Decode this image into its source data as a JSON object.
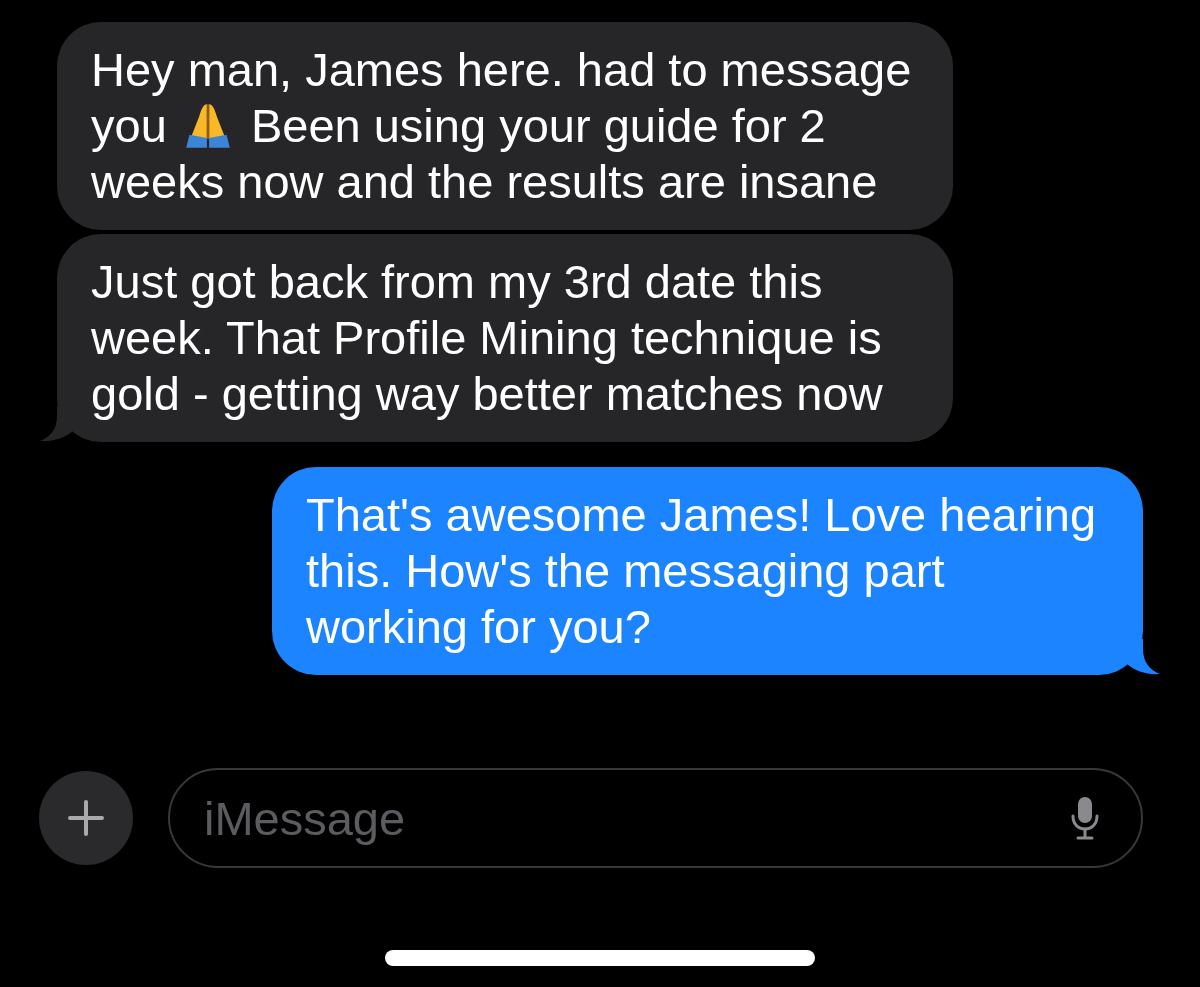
{
  "conversation": {
    "messages": [
      {
        "kind": "incoming",
        "tail": false,
        "parts": [
          {
            "kind": "text",
            "text": "Hey man, James here. had to message"
          },
          {
            "kind": "text",
            "text": "you"
          },
          {
            "kind": "emoji"
          },
          {
            "kind": "text",
            "text": "Been using your guide for 2"
          },
          {
            "kind": "text",
            "text": "weeks now and the results are insane"
          }
        ]
      },
      {
        "kind": "incoming",
        "tail": true,
        "parts": [
          {
            "kind": "text",
            "text": "Just got back from my 3rd date this week. That Profile Mining technique is gold - getting way better matches now"
          }
        ]
      },
      {
        "kind": "outgoing",
        "tail": true,
        "parts": [
          {
            "kind": "text",
            "text": "That's awesome James! Love hearing this. How's the messaging part working for you?"
          }
        ]
      }
    ]
  },
  "compose_bar": {
    "placeholder": "iMessage"
  }
}
